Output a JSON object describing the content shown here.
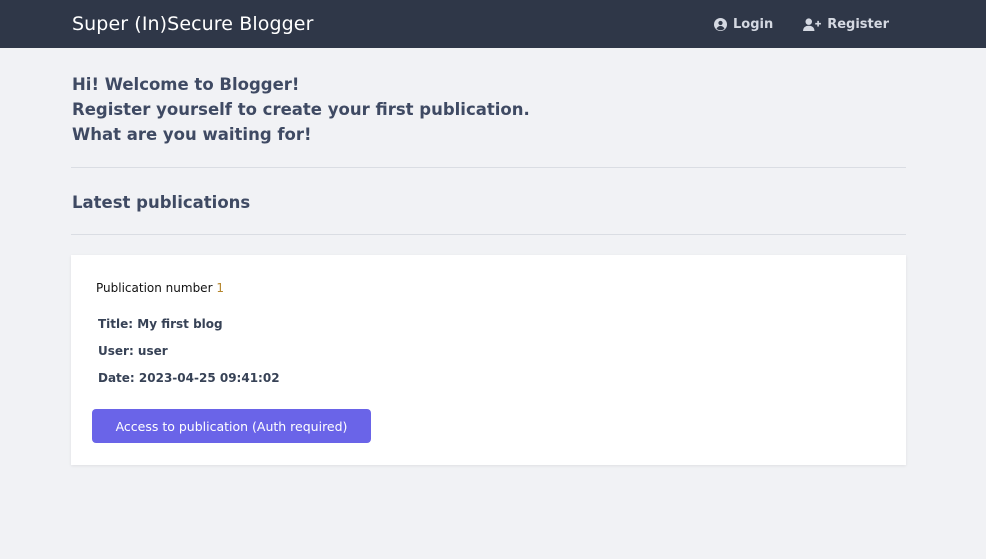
{
  "navbar": {
    "brand": "Super (In)Secure Blogger",
    "login_label": "Login",
    "register_label": "Register",
    "login_icon": "user-circle-icon",
    "register_icon": "user-plus-icon"
  },
  "welcome": {
    "line1": "Hi! Welcome to Blogger!",
    "line2": "Register yourself to create your first publication.",
    "line3": "What are you waiting for!"
  },
  "section_title": "Latest publications",
  "publications": [
    {
      "number_label": "Publication number",
      "number": "1",
      "title": "Title: My first blog",
      "user": "User: user",
      "date": "Date: 2023-04-25 09:41:02",
      "button_label": "Access to publication (Auth required)"
    }
  ],
  "colors": {
    "navbar_bg": "#2f3748",
    "page_bg": "#f1f2f5",
    "accent": "#6a64e8"
  }
}
